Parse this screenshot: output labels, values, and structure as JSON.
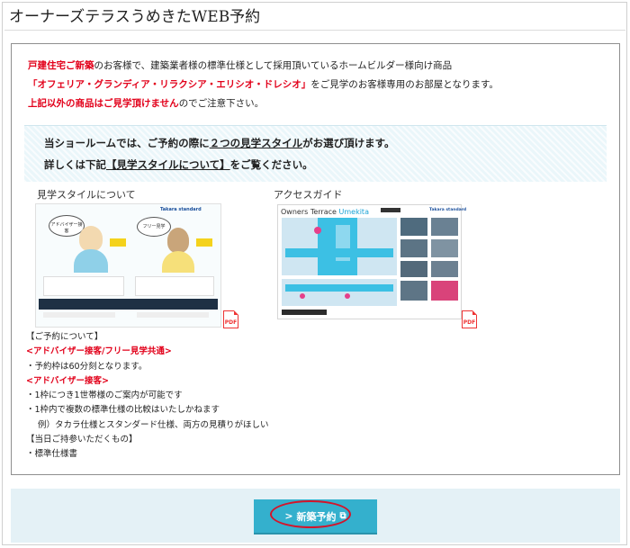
{
  "page": {
    "title": "オーナーズテラスうめきたWEB予約"
  },
  "notice": {
    "l1a": "戸建住宅ご新築",
    "l1b": "のお客様で、建築業者様の標準仕様として採用頂いているホームビルダー様向け商品",
    "l2a": "「オフェリア・グランディア・リラクシア・エリシオ・ドレシオ」",
    "l2b": "をご見学のお客様専用のお部屋となります。",
    "l3a": "上記以外の商品はご見学頂けません",
    "l3b": "のでご注意下さい。"
  },
  "banner": {
    "l1a": "当ショールームでは、ご予約の際に",
    "l1b": "２つの見学スタイル",
    "l1c": "がお選び頂けます。",
    "l2a": "詳しくは下記",
    "l2b": "【見学スタイルについて】",
    "l2c": "をご覧ください。"
  },
  "style_section": {
    "label": "見学スタイルについて",
    "brand": "Takara standard",
    "bubble_left": "アドバイザー接客",
    "bubble_right": "フリー見学",
    "pdf": "PDF"
  },
  "access_section": {
    "label": "アクセスガイド",
    "map_title_a": "Owners Terrace",
    "map_title_b": "Umekita",
    "brand": "Takara standard",
    "pdf": "PDF"
  },
  "info": {
    "reservation_header": "【ご予約について】",
    "common_header": "<アドバイザー接客/フリー見学共通>",
    "common_item": "・予約枠は60分刻となります。",
    "advisor_header": "<アドバイザー接客>",
    "advisor_item1": "・1枠につき1世帯様のご案内が可能です",
    "advisor_item2": "・1枠内で複数の標準仕様の比較はいたしかねます",
    "advisor_example": "例）タカラ仕様とスタンダード仕様、両方の見積りがほしい",
    "bring_header": "【当日ご持参いただくもの】",
    "bring_item": "・標準仕様書"
  },
  "footer": {
    "button_label": "新築予約",
    "chevron": ">",
    "ext_icon": "⧉"
  },
  "colors": {
    "accent_red": "#e2001a",
    "button_blue": "#34b0cd",
    "band_bg": "#e4f1f6"
  }
}
